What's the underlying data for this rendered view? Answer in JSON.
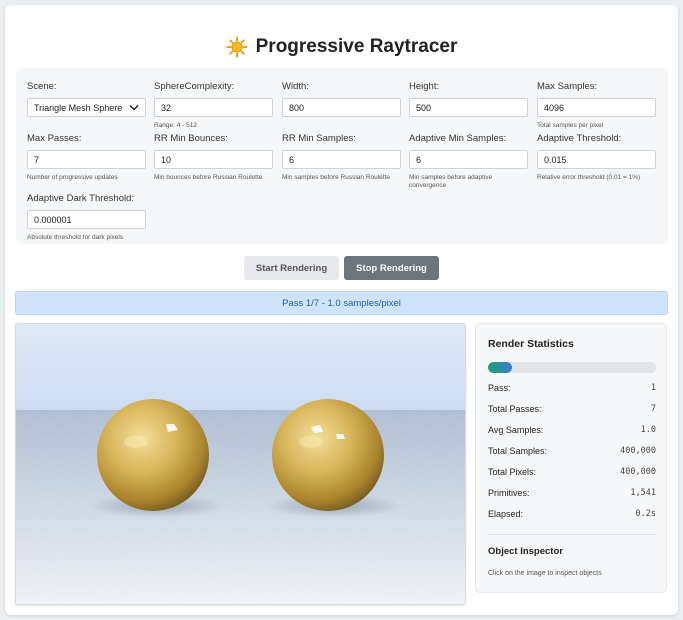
{
  "app": {
    "title": "Progressive Raytracer",
    "title_icon": "sun-icon"
  },
  "settings": {
    "scene": {
      "label": "Scene:",
      "value": "Triangle Mesh Sphere"
    },
    "sphere_complexity": {
      "label": "SphereComplexity:",
      "value": "32",
      "hint": "Range: 4 - 512"
    },
    "width": {
      "label": "Width:",
      "value": "800"
    },
    "height": {
      "label": "Height:",
      "value": "500"
    },
    "max_samples": {
      "label": "Max Samples:",
      "value": "4096",
      "hint": "Total samples per pixel"
    },
    "max_passes": {
      "label": "Max Passes:",
      "value": "7",
      "hint": "Number of progressive updates"
    },
    "rr_min_bounces": {
      "label": "RR Min Bounces:",
      "value": "10",
      "hint": "Min bounces before Russian Roulette"
    },
    "rr_min_samples": {
      "label": "RR Min Samples:",
      "value": "6",
      "hint": "Min samples before Russian Roulette"
    },
    "adaptive_min_samples": {
      "label": "Adaptive Min Samples:",
      "value": "6",
      "hint": "Min samples before adaptive convergence"
    },
    "adaptive_threshold": {
      "label": "Adaptive Threshold:",
      "value": "0.015",
      "hint": "Relative error threshold (0.01 = 1%)"
    },
    "adaptive_dark_threshold": {
      "label": "Adaptive Dark Threshold:",
      "value": "0.000001",
      "hint": "Absolute threshold for dark pixels"
    }
  },
  "buttons": {
    "start": "Start Rendering",
    "stop": "Stop Rendering"
  },
  "status": "Pass 1/7 - 1.0 samples/pixel",
  "stats": {
    "title": "Render Statistics",
    "progress_fraction": 0.14,
    "rows": [
      {
        "label": "Pass:",
        "value": "1"
      },
      {
        "label": "Total Passes:",
        "value": "7"
      },
      {
        "label": "Avg Samples:",
        "value": "1.0"
      },
      {
        "label": "Total Samples:",
        "value": "400,000"
      },
      {
        "label": "Total Pixels:",
        "value": "400,000"
      },
      {
        "label": "Primitives:",
        "value": "1,541"
      },
      {
        "label": "Elapsed:",
        "value": "0.2s"
      }
    ],
    "inspector_title": "Object Inspector",
    "inspector_hint": "Click on the image to inspect objects"
  },
  "colors": {
    "accent_blue": "#1a5fa6",
    "status_bg": "#cfe4fb",
    "stop_button": "#6c757d",
    "progress_start": "#1e9c6e",
    "progress_end": "#3b7fd1"
  }
}
